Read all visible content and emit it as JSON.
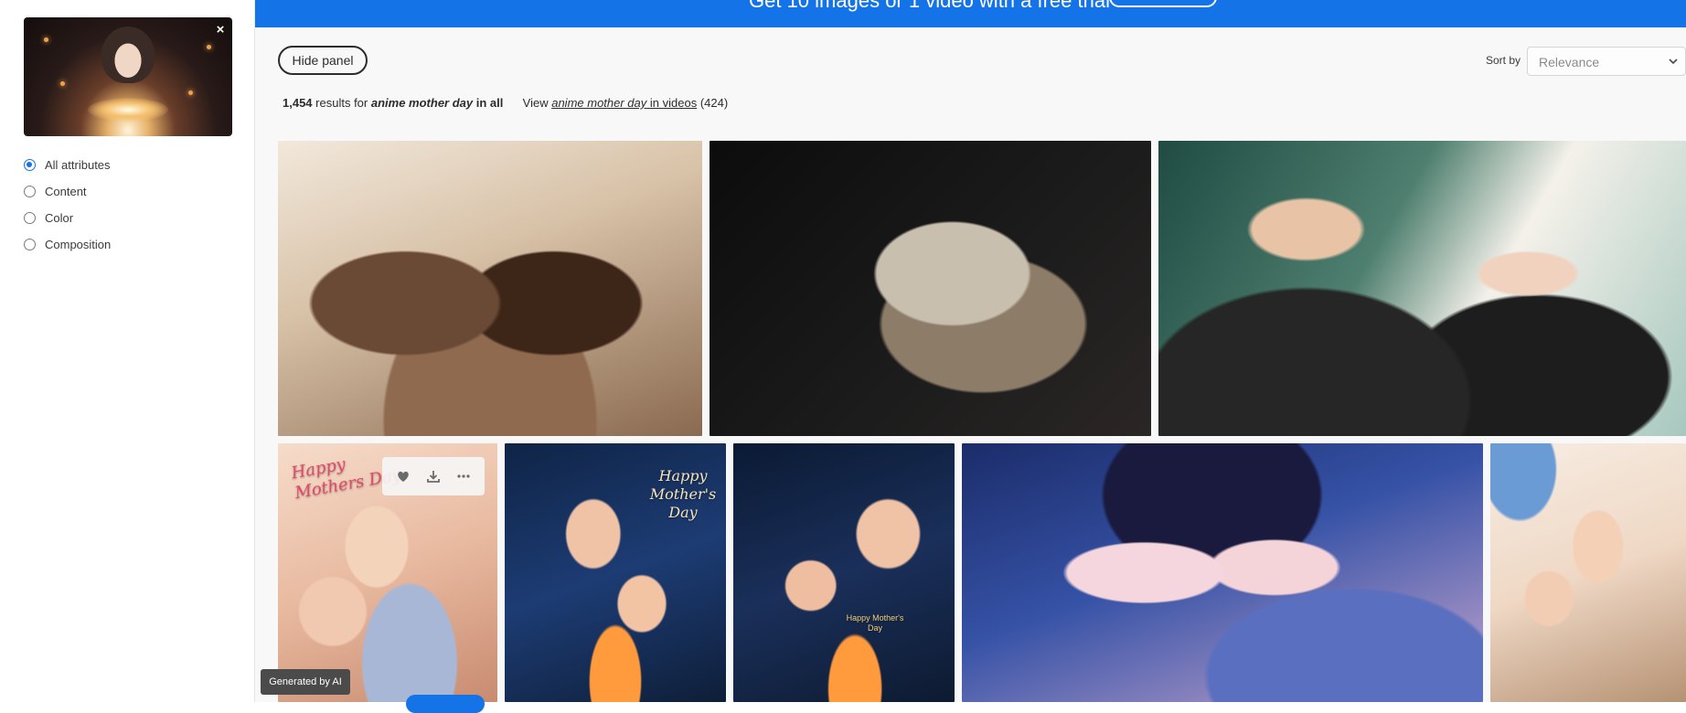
{
  "filter_panel": {
    "close_label": "×",
    "options": [
      {
        "label": "All attributes",
        "checked": true
      },
      {
        "label": "Content",
        "checked": false
      },
      {
        "label": "Color",
        "checked": false
      },
      {
        "label": "Composition",
        "checked": false
      }
    ],
    "badge": "Generated by AI"
  },
  "banner": {
    "text": "Get 10 images or 1 video with a free trial"
  },
  "toolbar": {
    "hide_panel_label": "Hide panel",
    "sort_label": "Sort by",
    "sort_value": "Relevance"
  },
  "results": {
    "count": "1,454",
    "prefix": "results for",
    "query": "anime mother day",
    "scope": "in all",
    "view_label": "View",
    "view_link_query": "anime mother day",
    "view_link_suffix": "in videos",
    "video_count": "(424)"
  },
  "tiles": {
    "t4_text": "Happy Mothers Day",
    "t5_text": "Happy Mother's Day",
    "t6_text": "Happy Mother's Day"
  },
  "icons": {
    "heart": "heart-icon",
    "download": "download-icon",
    "more": "more-icon",
    "chevron": "chevron-down-icon"
  },
  "colors": {
    "accent": "#1473e6",
    "badge_bg": "#4b4b4b"
  }
}
